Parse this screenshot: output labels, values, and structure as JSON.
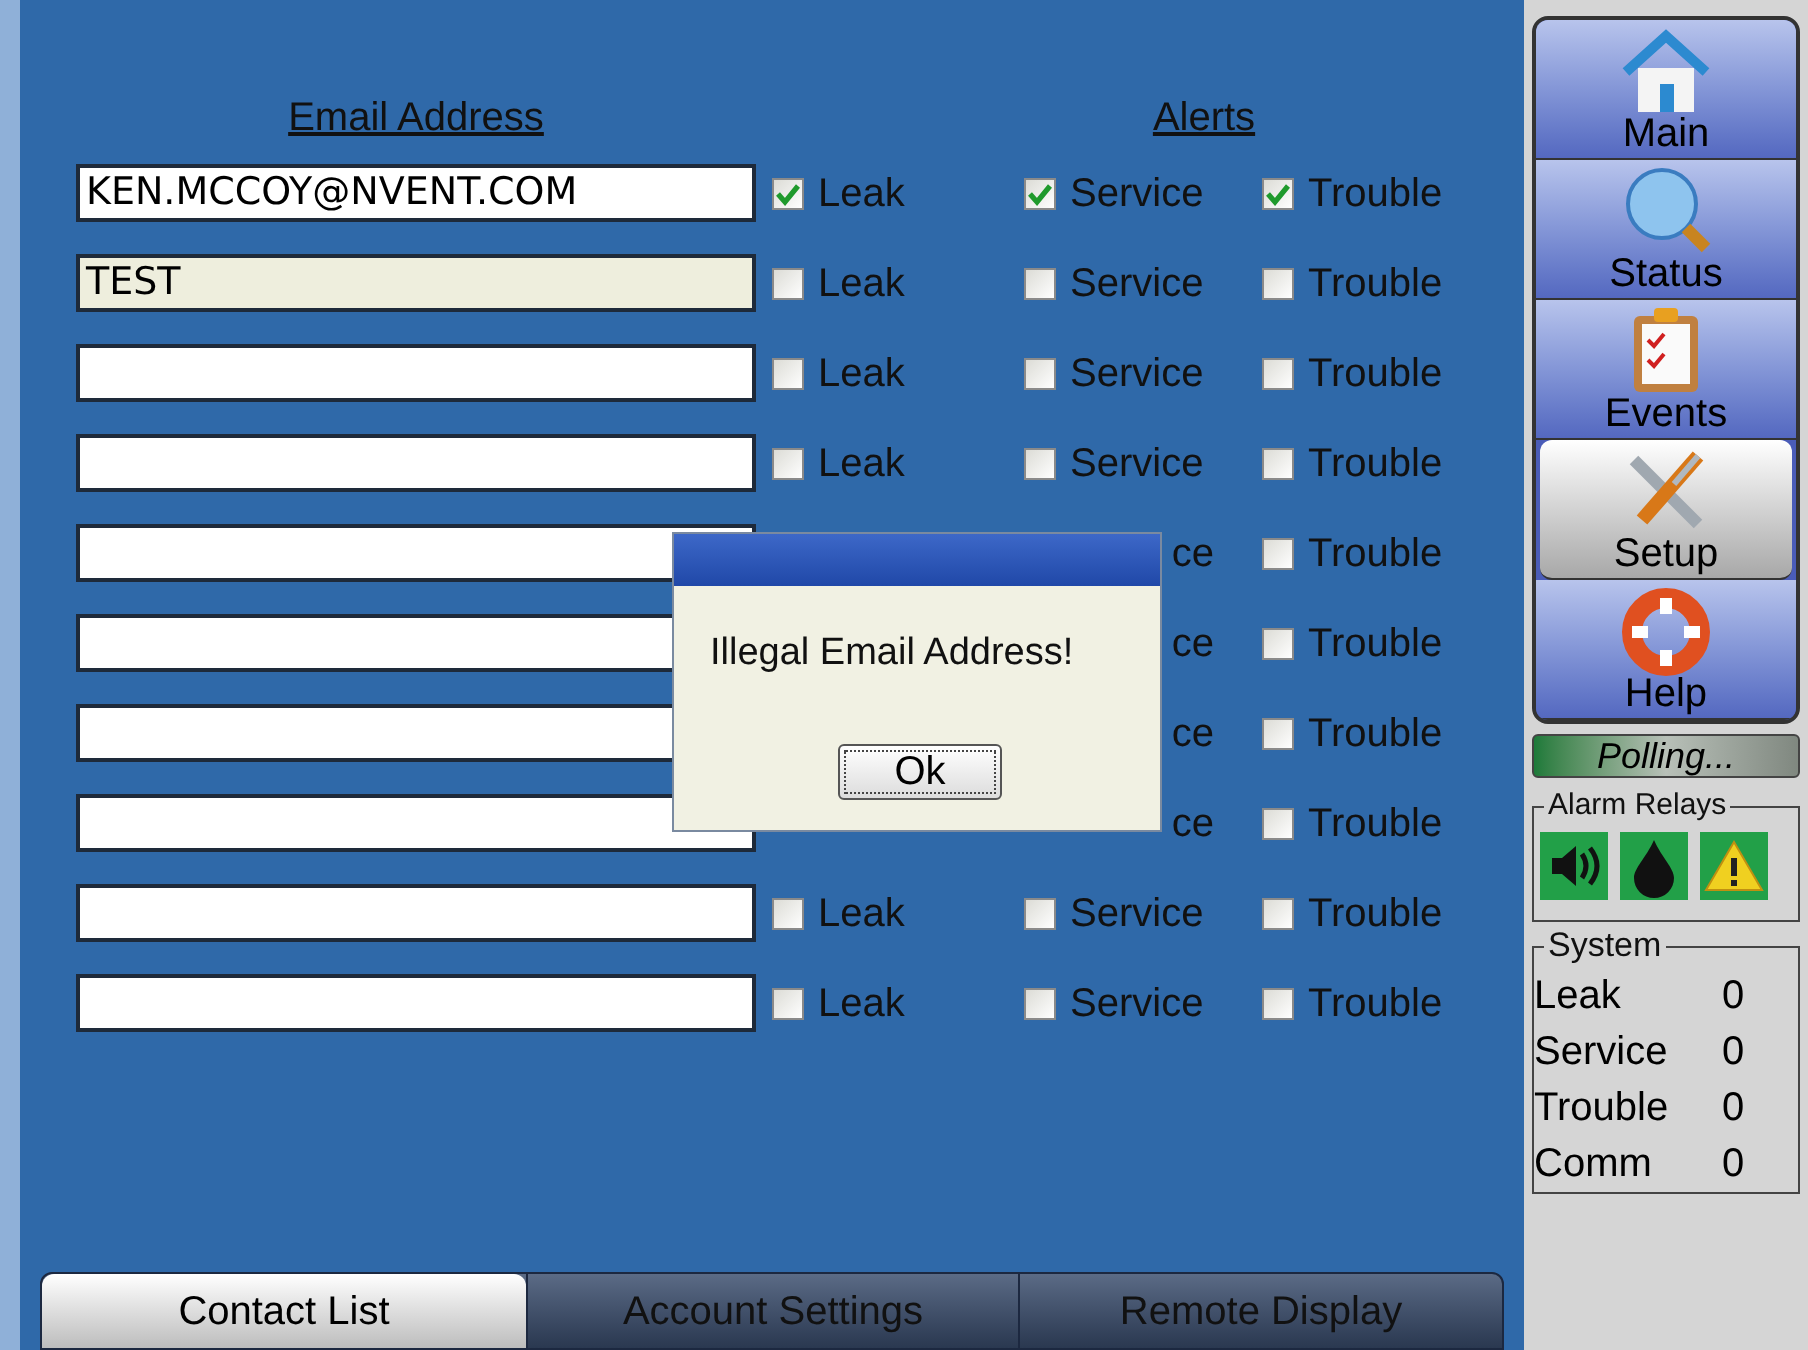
{
  "contacts": {
    "email_header": "Email Address",
    "alerts_header": "Alerts",
    "rows": [
      {
        "email": "KEN.MCCOY@NVENT.COM",
        "focused": false,
        "alerts": [
          {
            "kind": "leak",
            "label": "Leak",
            "checked": true
          },
          {
            "kind": "service",
            "label": "Service",
            "checked": true
          },
          {
            "kind": "trouble",
            "label": "Trouble",
            "checked": true
          }
        ]
      },
      {
        "email": "TEST",
        "focused": true,
        "alerts": [
          {
            "kind": "leak",
            "label": "Leak",
            "checked": false
          },
          {
            "kind": "service",
            "label": "Service",
            "checked": false
          },
          {
            "kind": "trouble",
            "label": "Trouble",
            "checked": false
          }
        ]
      },
      {
        "focused": false,
        "alerts": [
          {
            "kind": "leak",
            "label": "Leak",
            "checked": false
          },
          {
            "kind": "service",
            "label": "Service",
            "checked": false
          },
          {
            "kind": "trouble",
            "label": "Trouble",
            "checked": false
          }
        ]
      },
      {
        "focused": false,
        "alerts": [
          {
            "kind": "leak",
            "label": "Leak",
            "checked": false
          },
          {
            "kind": "service",
            "label": "Service",
            "checked": false
          },
          {
            "kind": "trouble",
            "label": "Trouble",
            "checked": false
          }
        ]
      },
      {
        "focused": false,
        "alerts": [
          {
            "kind": "service",
            "label": "ce"
          },
          {
            "kind": "trouble",
            "label": "Trouble",
            "checked": false
          }
        ]
      },
      {
        "focused": false,
        "alerts": [
          {
            "kind": "service",
            "label": "ce"
          },
          {
            "kind": "trouble",
            "label": "Trouble",
            "checked": false
          }
        ]
      },
      {
        "focused": false,
        "alerts": [
          {
            "kind": "service",
            "label": "ce"
          },
          {
            "kind": "trouble",
            "label": "Trouble",
            "checked": false
          }
        ]
      },
      {
        "focused": false,
        "alerts": [
          {
            "kind": "service",
            "label": "ce"
          },
          {
            "kind": "trouble",
            "label": "Trouble",
            "checked": false
          }
        ]
      },
      {
        "focused": false,
        "alerts": [
          {
            "kind": "leak",
            "label": "Leak",
            "checked": false
          },
          {
            "kind": "service",
            "label": "Service",
            "checked": false
          },
          {
            "kind": "trouble",
            "label": "Trouble",
            "checked": false
          }
        ]
      },
      {
        "focused": false,
        "alerts": [
          {
            "kind": "leak",
            "label": "Leak",
            "checked": false
          },
          {
            "kind": "service",
            "label": "Service",
            "checked": false
          },
          {
            "kind": "trouble",
            "label": "Trouble",
            "checked": false
          }
        ]
      }
    ]
  },
  "dialog": {
    "message": "Illegal Email Address!",
    "button": "Ok"
  },
  "tabs": [
    {
      "label": "Contact List",
      "selected": true
    },
    {
      "label": "Account Settings",
      "selected": false
    },
    {
      "label": "Remote Display",
      "selected": false
    }
  ],
  "nav": [
    {
      "kind": "house",
      "label": "Main",
      "selected": false
    },
    {
      "kind": "magnifier",
      "label": "Status",
      "selected": false
    },
    {
      "kind": "clipboard",
      "label": "Events",
      "selected": false
    },
    {
      "kind": "tools",
      "label": "Setup",
      "selected": true
    },
    {
      "kind": "lifebuoy",
      "label": "Help",
      "selected": false
    }
  ],
  "status": {
    "label": "Polling..."
  },
  "alarm_relays": {
    "title": "Alarm Relays",
    "items": [
      {
        "kind": "speaker"
      },
      {
        "kind": "drop"
      },
      {
        "kind": "warning"
      }
    ]
  },
  "system": {
    "title": "System",
    "rows": [
      {
        "label": "Leak",
        "value": "0"
      },
      {
        "label": "Service",
        "value": "0"
      },
      {
        "label": "Trouble",
        "value": "0"
      },
      {
        "label": "Comm",
        "value": "0"
      }
    ]
  }
}
